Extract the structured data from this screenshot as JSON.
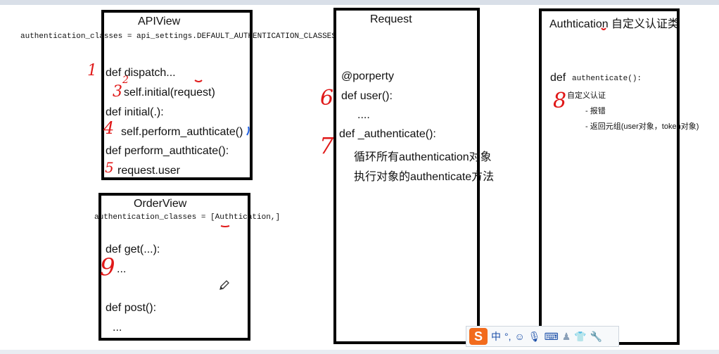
{
  "apiview": {
    "title": "APIView",
    "auth_line": "authentication_classes = api_settings.DEFAULT_AUTHENTICATION_CLASSES",
    "lines": [
      "def dispatch...",
      "self.initial(request)",
      "def initial(.):",
      "self.perform_authticate()",
      "def perform_authticate():",
      "request.user"
    ]
  },
  "orderview": {
    "title": "OrderView",
    "auth_line": "authentication_classes = [Authtication,]",
    "lines": [
      "def get(...):",
      "...",
      "def post():",
      "..."
    ]
  },
  "request": {
    "title": "Request",
    "lines": [
      "@porperty",
      "def user():",
      "....",
      "def _authenticate():",
      "循环所有authentication对象",
      "执行对象的authenticate方法"
    ]
  },
  "authtication": {
    "title": "Authtication 自定义认证类",
    "def_kw": "def",
    "def_name": "authenticate():",
    "lines": [
      "自定义认证",
      "- 报错",
      "- 返回元组(user对象，token对象)"
    ]
  },
  "annotations": [
    "1",
    "2",
    "3",
    "4",
    "5",
    "6",
    "7",
    "8",
    "9"
  ],
  "ime_toolbar": {
    "logo": "S",
    "lang": "中",
    "icons": [
      "punctuation-icon",
      "emoji-icon",
      "microphone-icon",
      "keyboard-icon",
      "user-icon",
      "shirt-icon",
      "wrench-icon"
    ]
  },
  "colors": {
    "annotation": "#e01818",
    "border": "#000000",
    "ime_logo": "#f26b1d"
  }
}
